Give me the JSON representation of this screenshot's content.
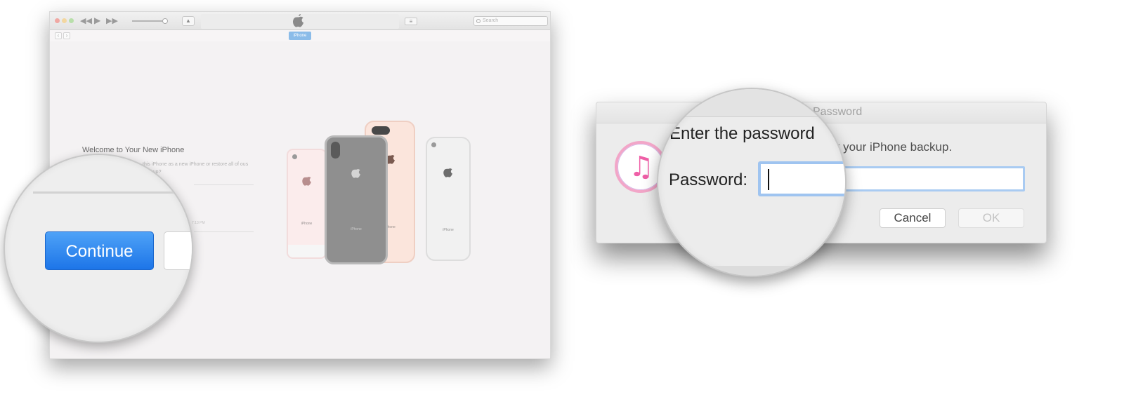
{
  "itunes": {
    "search_placeholder": "Search",
    "device_tab_label": "iPhone",
    "welcome_title": "Welcome to Your New iPhone",
    "welcome_desc": "this iPhone as a new iPhone or restore all of ous backup?",
    "faint_time": "7:13 PM",
    "phone_labels": [
      "iPhone",
      "iPhone",
      "iPhone",
      "iPhone"
    ],
    "continue_label": "Continue"
  },
  "dialog": {
    "title_partial": "Password",
    "message_partial": "ock your iPhone backup.",
    "cancel_label": "Cancel",
    "ok_label": "OK"
  },
  "magnifier": {
    "message": "Enter the password",
    "password_label": "Password:"
  },
  "colors": {
    "continue_button": "#1d75e8",
    "password_field_border": "#a9cbf2",
    "device_pill": "#8bbce9"
  }
}
